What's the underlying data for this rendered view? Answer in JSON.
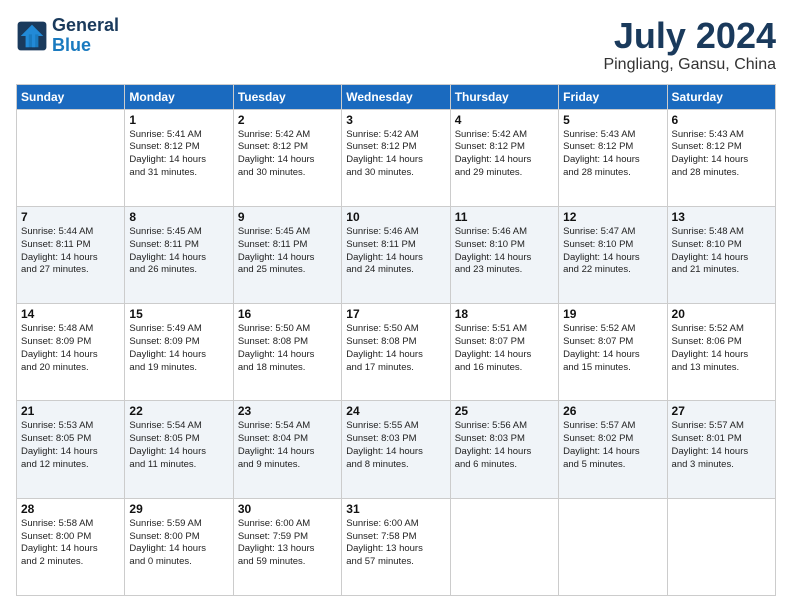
{
  "logo": {
    "line1": "General",
    "line2": "Blue"
  },
  "title": "July 2024",
  "subtitle": "Pingliang, Gansu, China",
  "headers": [
    "Sunday",
    "Monday",
    "Tuesday",
    "Wednesday",
    "Thursday",
    "Friday",
    "Saturday"
  ],
  "weeks": [
    [
      {
        "day": "",
        "info": ""
      },
      {
        "day": "1",
        "info": "Sunrise: 5:41 AM\nSunset: 8:12 PM\nDaylight: 14 hours\nand 31 minutes."
      },
      {
        "day": "2",
        "info": "Sunrise: 5:42 AM\nSunset: 8:12 PM\nDaylight: 14 hours\nand 30 minutes."
      },
      {
        "day": "3",
        "info": "Sunrise: 5:42 AM\nSunset: 8:12 PM\nDaylight: 14 hours\nand 30 minutes."
      },
      {
        "day": "4",
        "info": "Sunrise: 5:42 AM\nSunset: 8:12 PM\nDaylight: 14 hours\nand 29 minutes."
      },
      {
        "day": "5",
        "info": "Sunrise: 5:43 AM\nSunset: 8:12 PM\nDaylight: 14 hours\nand 28 minutes."
      },
      {
        "day": "6",
        "info": "Sunrise: 5:43 AM\nSunset: 8:12 PM\nDaylight: 14 hours\nand 28 minutes."
      }
    ],
    [
      {
        "day": "7",
        "info": "Sunrise: 5:44 AM\nSunset: 8:11 PM\nDaylight: 14 hours\nand 27 minutes."
      },
      {
        "day": "8",
        "info": "Sunrise: 5:45 AM\nSunset: 8:11 PM\nDaylight: 14 hours\nand 26 minutes."
      },
      {
        "day": "9",
        "info": "Sunrise: 5:45 AM\nSunset: 8:11 PM\nDaylight: 14 hours\nand 25 minutes."
      },
      {
        "day": "10",
        "info": "Sunrise: 5:46 AM\nSunset: 8:11 PM\nDaylight: 14 hours\nand 24 minutes."
      },
      {
        "day": "11",
        "info": "Sunrise: 5:46 AM\nSunset: 8:10 PM\nDaylight: 14 hours\nand 23 minutes."
      },
      {
        "day": "12",
        "info": "Sunrise: 5:47 AM\nSunset: 8:10 PM\nDaylight: 14 hours\nand 22 minutes."
      },
      {
        "day": "13",
        "info": "Sunrise: 5:48 AM\nSunset: 8:10 PM\nDaylight: 14 hours\nand 21 minutes."
      }
    ],
    [
      {
        "day": "14",
        "info": "Sunrise: 5:48 AM\nSunset: 8:09 PM\nDaylight: 14 hours\nand 20 minutes."
      },
      {
        "day": "15",
        "info": "Sunrise: 5:49 AM\nSunset: 8:09 PM\nDaylight: 14 hours\nand 19 minutes."
      },
      {
        "day": "16",
        "info": "Sunrise: 5:50 AM\nSunset: 8:08 PM\nDaylight: 14 hours\nand 18 minutes."
      },
      {
        "day": "17",
        "info": "Sunrise: 5:50 AM\nSunset: 8:08 PM\nDaylight: 14 hours\nand 17 minutes."
      },
      {
        "day": "18",
        "info": "Sunrise: 5:51 AM\nSunset: 8:07 PM\nDaylight: 14 hours\nand 16 minutes."
      },
      {
        "day": "19",
        "info": "Sunrise: 5:52 AM\nSunset: 8:07 PM\nDaylight: 14 hours\nand 15 minutes."
      },
      {
        "day": "20",
        "info": "Sunrise: 5:52 AM\nSunset: 8:06 PM\nDaylight: 14 hours\nand 13 minutes."
      }
    ],
    [
      {
        "day": "21",
        "info": "Sunrise: 5:53 AM\nSunset: 8:05 PM\nDaylight: 14 hours\nand 12 minutes."
      },
      {
        "day": "22",
        "info": "Sunrise: 5:54 AM\nSunset: 8:05 PM\nDaylight: 14 hours\nand 11 minutes."
      },
      {
        "day": "23",
        "info": "Sunrise: 5:54 AM\nSunset: 8:04 PM\nDaylight: 14 hours\nand 9 minutes."
      },
      {
        "day": "24",
        "info": "Sunrise: 5:55 AM\nSunset: 8:03 PM\nDaylight: 14 hours\nand 8 minutes."
      },
      {
        "day": "25",
        "info": "Sunrise: 5:56 AM\nSunset: 8:03 PM\nDaylight: 14 hours\nand 6 minutes."
      },
      {
        "day": "26",
        "info": "Sunrise: 5:57 AM\nSunset: 8:02 PM\nDaylight: 14 hours\nand 5 minutes."
      },
      {
        "day": "27",
        "info": "Sunrise: 5:57 AM\nSunset: 8:01 PM\nDaylight: 14 hours\nand 3 minutes."
      }
    ],
    [
      {
        "day": "28",
        "info": "Sunrise: 5:58 AM\nSunset: 8:00 PM\nDaylight: 14 hours\nand 2 minutes."
      },
      {
        "day": "29",
        "info": "Sunrise: 5:59 AM\nSunset: 8:00 PM\nDaylight: 14 hours\nand 0 minutes."
      },
      {
        "day": "30",
        "info": "Sunrise: 6:00 AM\nSunset: 7:59 PM\nDaylight: 13 hours\nand 59 minutes."
      },
      {
        "day": "31",
        "info": "Sunrise: 6:00 AM\nSunset: 7:58 PM\nDaylight: 13 hours\nand 57 minutes."
      },
      {
        "day": "",
        "info": ""
      },
      {
        "day": "",
        "info": ""
      },
      {
        "day": "",
        "info": ""
      }
    ]
  ]
}
